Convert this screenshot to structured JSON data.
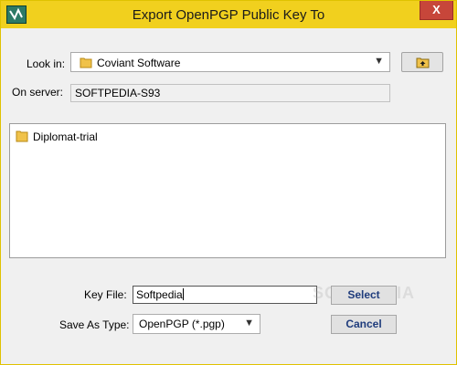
{
  "window": {
    "title": "Export OpenPGP Public Key To",
    "close_glyph": "X",
    "icon": "app-logo-icon"
  },
  "look_in": {
    "label": "Look in:",
    "value": "Coviant Software",
    "icon": "folder-icon",
    "up_button_icon": "folder-up-icon"
  },
  "server": {
    "label": "On server:",
    "value": "SOFTPEDIA-S93"
  },
  "file_list": {
    "items": [
      {
        "name": "Diplomat-trial",
        "icon": "folder-icon"
      }
    ]
  },
  "key_file": {
    "label": "Key File:",
    "value": "Softpedia"
  },
  "save_as_type": {
    "label": "Save As Type:",
    "value": "OpenPGP (*.pgp)"
  },
  "buttons": {
    "select_label": "Select",
    "cancel_label": "Cancel"
  },
  "watermark": "SOFTPEDIA"
}
